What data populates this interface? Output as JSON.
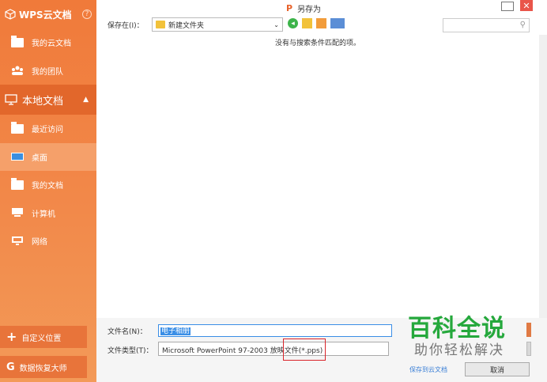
{
  "sidebar": {
    "header": "WPS云文档",
    "help": "?",
    "cloud_items": [
      {
        "label": "我的云文档",
        "icon": "cloud-doc-icon"
      },
      {
        "label": "我的团队",
        "icon": "team-icon"
      }
    ],
    "local_section": {
      "label": "本地文档",
      "icon": "monitor-icon",
      "caret": "▲"
    },
    "local_items": [
      {
        "label": "最近访问",
        "icon": "recent-folder-icon"
      },
      {
        "label": "桌面",
        "icon": "desktop-icon"
      },
      {
        "label": "我的文档",
        "icon": "documents-folder-icon"
      },
      {
        "label": "计算机",
        "icon": "computer-icon"
      },
      {
        "label": "网络",
        "icon": "network-icon"
      }
    ],
    "custom_location": {
      "label": "自定义位置",
      "icon": "+"
    },
    "data_recovery": {
      "label": "数据恢复大师",
      "icon": "G"
    }
  },
  "titlebar": {
    "title": "另存为",
    "app_icon": "P",
    "close": "✕"
  },
  "toolbar": {
    "save_in_label": "保存在(I)：",
    "current_folder": "新建文件夹",
    "dropdown_arrow": "⌄",
    "back_glyph": "◂",
    "search_placeholder": "",
    "search_glyph": "⚲"
  },
  "file_area": {
    "empty_message": "没有与搜索条件匹配的项。"
  },
  "form": {
    "filename_label": "文件名(N)：",
    "filename_value": "电子相册",
    "filetype_label": "文件类型(T)：",
    "filetype_value": "Microsoft PowerPoint 97-2003 放映文件(*.pps)",
    "save_to_cloud": "保存到云文档",
    "cancel": "取消"
  },
  "watermark": {
    "main": "百科全说",
    "sub": "助你轻松解决"
  }
}
